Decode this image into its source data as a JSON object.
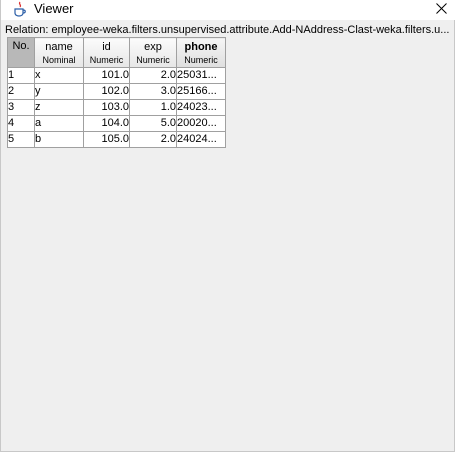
{
  "window": {
    "title": "Viewer",
    "app_icon": "java-cup-icon",
    "close_icon": "close-icon"
  },
  "relation": {
    "text": "Relation: employee-weka.filters.unsupervised.attribute.Add-NAddress-Clast-weka.filters.u..."
  },
  "table": {
    "columns": [
      {
        "name": "No.",
        "type": ""
      },
      {
        "name": "name",
        "type": "Nominal"
      },
      {
        "name": "id",
        "type": "Numeric"
      },
      {
        "name": "exp",
        "type": "Numeric"
      },
      {
        "name": "phone",
        "type": "Numeric"
      }
    ],
    "rows": [
      {
        "no": "1",
        "name": "x",
        "id": "101.0",
        "exp": "2.0",
        "phone": "25031..."
      },
      {
        "no": "2",
        "name": "y",
        "id": "102.0",
        "exp": "3.0",
        "phone": "25166..."
      },
      {
        "no": "3",
        "name": "z",
        "id": "103.0",
        "exp": "1.0",
        "phone": "24023..."
      },
      {
        "no": "4",
        "name": "a",
        "id": "104.0",
        "exp": "5.0",
        "phone": "20020..."
      },
      {
        "no": "5",
        "name": "b",
        "id": "105.0",
        "exp": "2.0",
        "phone": "24024..."
      }
    ]
  },
  "colors": {
    "header_gray": "#b8b8b8",
    "grid_line": "#a0a0a0",
    "background": "#efefef"
  }
}
